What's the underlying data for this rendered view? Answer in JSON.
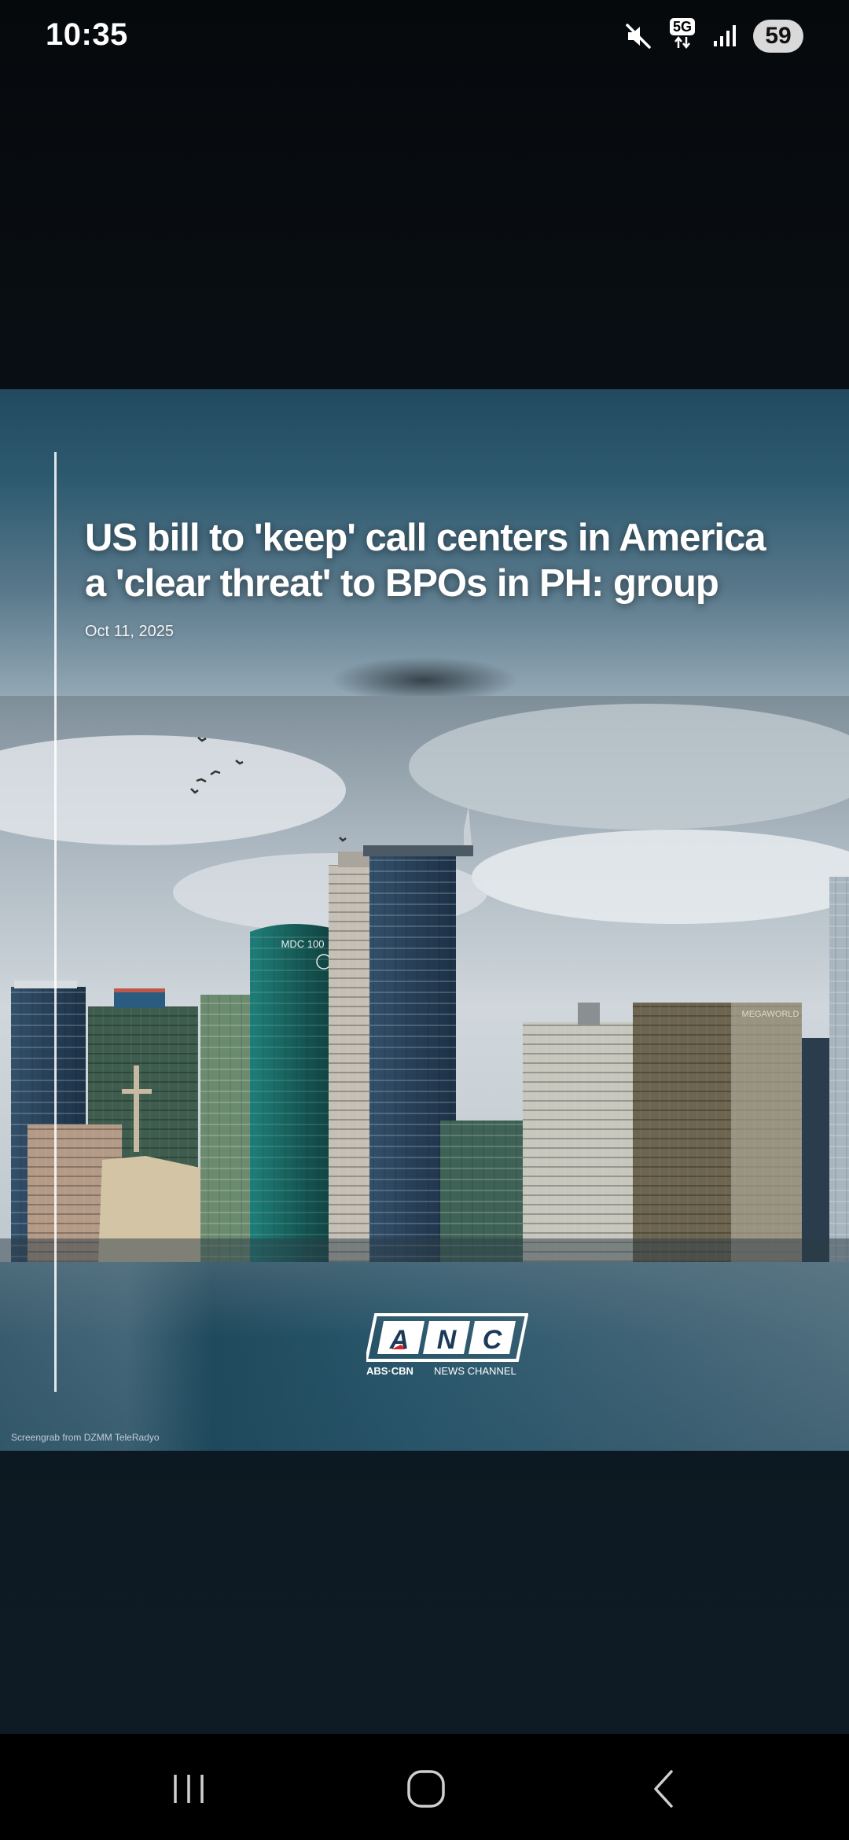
{
  "status_bar": {
    "time": "10:35",
    "network": "5G",
    "battery": "59",
    "icons": [
      "mute-icon",
      "5g-icon",
      "signal-icon",
      "battery-icon"
    ]
  },
  "story": {
    "headline_line1": "US bill to 'keep' call centers in America",
    "headline_line2": "a 'clear threat' to BPOs in PH: group",
    "date": "Oct 11, 2025",
    "photo_sign_left": "MDC 100",
    "photo_sign_right": "MEGAWORLD",
    "logo": {
      "letters": [
        "A",
        "N",
        "C"
      ],
      "subtitle_brand": "ABS·CBN",
      "subtitle_rest": "NEWS CHANNEL"
    },
    "credit": "Screengrab from DZMM TeleRadyo"
  },
  "nav_bar": {
    "items": [
      "recent-apps-icon",
      "home-icon",
      "back-icon"
    ]
  },
  "colors": {
    "accent_red": "#d4232b",
    "card_blue": "#24495e"
  }
}
